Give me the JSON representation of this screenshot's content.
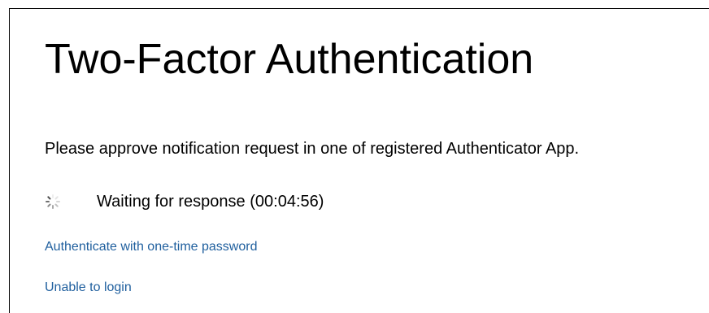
{
  "header": {
    "title": "Two-Factor Authentication"
  },
  "main": {
    "instructions": "Please approve notification request in one of registered Authenticator App.",
    "waiting": {
      "label": "Waiting for response (00:04:56)",
      "spinner_icon": "loading-spinner-icon"
    },
    "links": {
      "one_time_password": "Authenticate with one-time password",
      "unable_to_login": "Unable to login"
    }
  },
  "colors": {
    "link": "#1f5f9e",
    "text": "#000000",
    "background": "#ffffff"
  }
}
